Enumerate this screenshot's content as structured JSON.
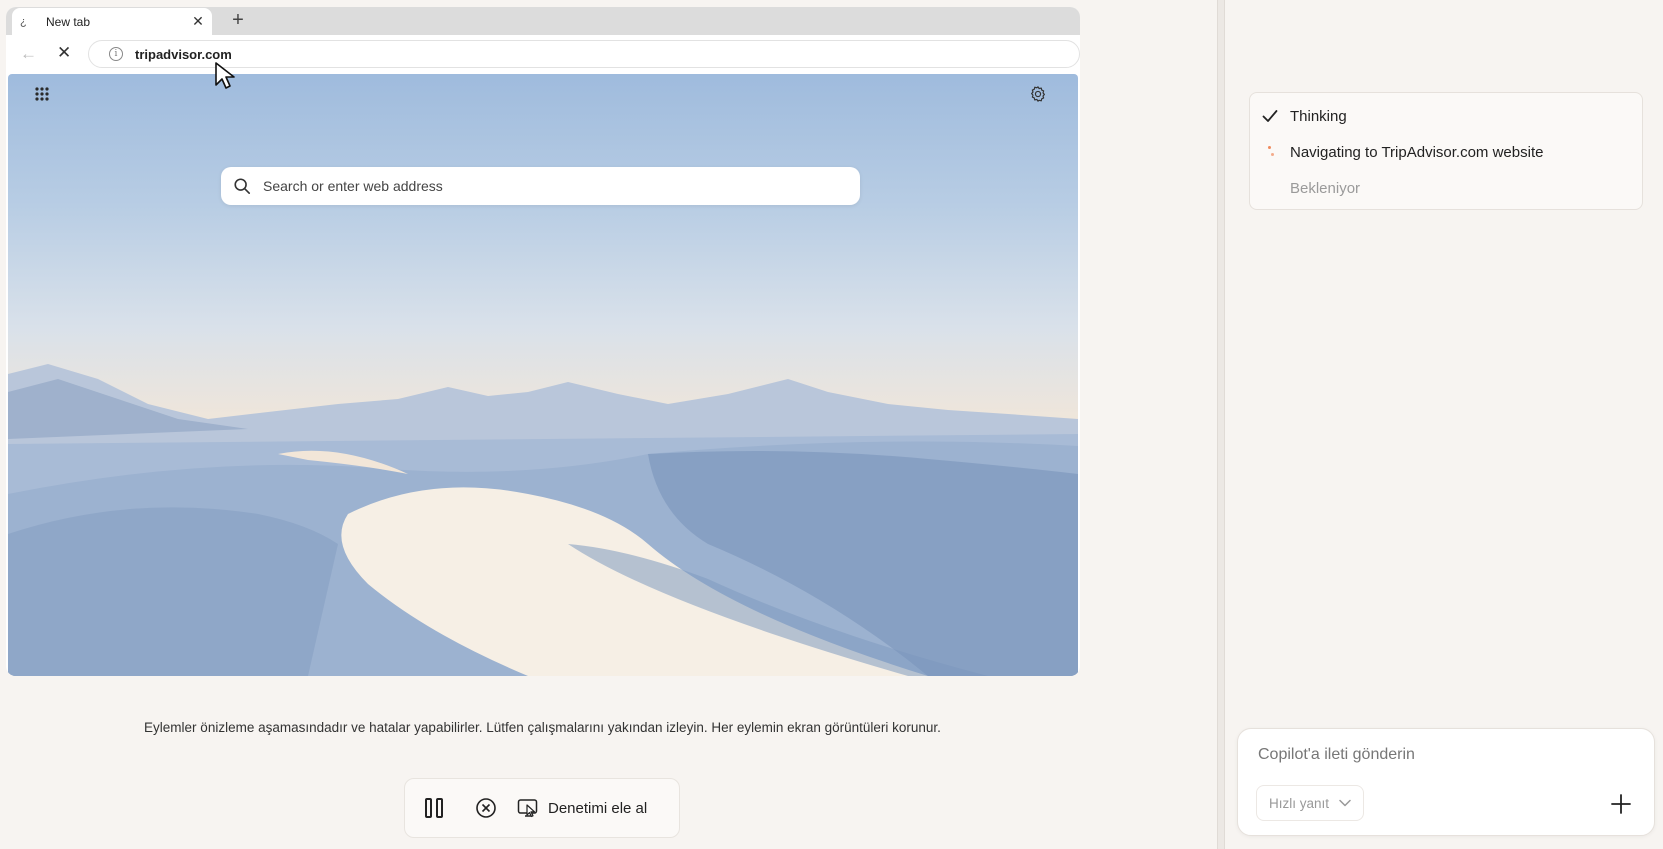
{
  "browser": {
    "tab": {
      "favicon": "¿",
      "title": "New tab",
      "close_glyph": "✕"
    },
    "new_tab_glyph": "+",
    "back_glyph": "←",
    "stop_glyph": "✕",
    "address": "tripadvisor.com",
    "info_glyph": "i",
    "search_placeholder": "Search or enter web address",
    "icons": [
      "apps-grid-icon",
      "settings-gear-icon",
      "search-icon",
      "info-icon",
      "cursor-icon"
    ]
  },
  "disclaimer": "Eylemler önizleme aşamasındadır ve hatalar yapabilirler. Lütfen çalışmalarını yakından izleyin. Her eylemin ekran görüntüleri korunur.",
  "controls": {
    "takeover_label": "Denetimi ele al",
    "icons": [
      "pause-icon",
      "stop-circle-icon",
      "takeover-icon"
    ]
  },
  "copilot": {
    "steps": [
      {
        "label": "Thinking",
        "status": "done",
        "icon": "check-icon"
      },
      {
        "label": "Navigating to TripAdvisor.com website",
        "status": "in-progress",
        "icon": "loading-dots-icon"
      },
      {
        "label": "Bekleniyor",
        "status": "pending",
        "icon": ""
      }
    ],
    "input_placeholder": "Copilot'a ileti gönderin",
    "mode_label": "Hızlı yanıt",
    "accent_color": "#f08a5d"
  }
}
